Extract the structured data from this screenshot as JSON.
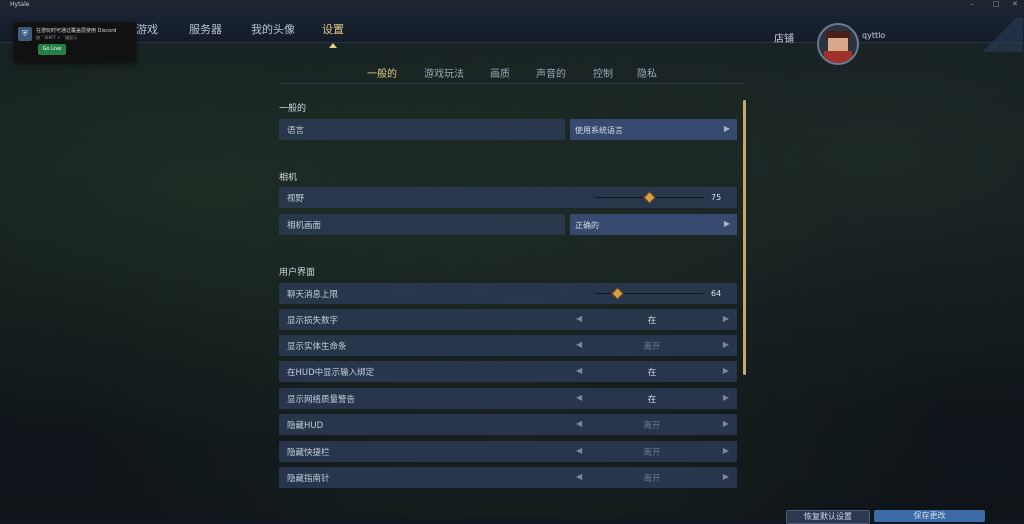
{
  "window": {
    "title": "Hytale"
  },
  "notification": {
    "title": "在游玩时可通过覆盖层使用 Discord",
    "subtitle": "按 ` SHIFT + ` 键显示",
    "button": "Go Live"
  },
  "nav": {
    "items": [
      "游戏",
      "服务器",
      "我的头像",
      "设置"
    ],
    "active": "设置",
    "store": "店铺",
    "username": "qyttlo"
  },
  "tabs": [
    "一般的",
    "游戏玩法",
    "画质",
    "声音的",
    "控制",
    "隐私"
  ],
  "active_tab": "一般的",
  "sections": {
    "general": {
      "title": "一般的",
      "language": {
        "label": "语言",
        "value": "使用系统语言"
      }
    },
    "camera": {
      "title": "相机",
      "fov": {
        "label": "视野",
        "value": "75",
        "fraction": 0.5
      },
      "camera_mode": {
        "label": "相机画面",
        "value": "正确的"
      }
    },
    "ui": {
      "title": "用户界面",
      "chat_limit": {
        "label": "聊天消息上限",
        "value": "64",
        "fraction": 0.2
      },
      "rows": [
        {
          "label": "显示损失数字",
          "value": "在",
          "off": false
        },
        {
          "label": "显示实体生命条",
          "value": "离开",
          "off": true
        },
        {
          "label": "在HUD中显示输入绑定",
          "value": "在",
          "off": false
        },
        {
          "label": "显示网络质量警告",
          "value": "在",
          "off": false
        },
        {
          "label": "隐藏HUD",
          "value": "离开",
          "off": true
        },
        {
          "label": "隐藏快捷栏",
          "value": "离开",
          "off": true
        },
        {
          "label": "隐藏指南针",
          "value": "离开",
          "off": true
        }
      ]
    }
  },
  "footer": {
    "reset_label": "恢复默认设置",
    "apply_label": "保存更改"
  },
  "colors": {
    "accent": "#e8c987",
    "row_bg": "#2c3a54",
    "value_bg": "#36496e"
  }
}
